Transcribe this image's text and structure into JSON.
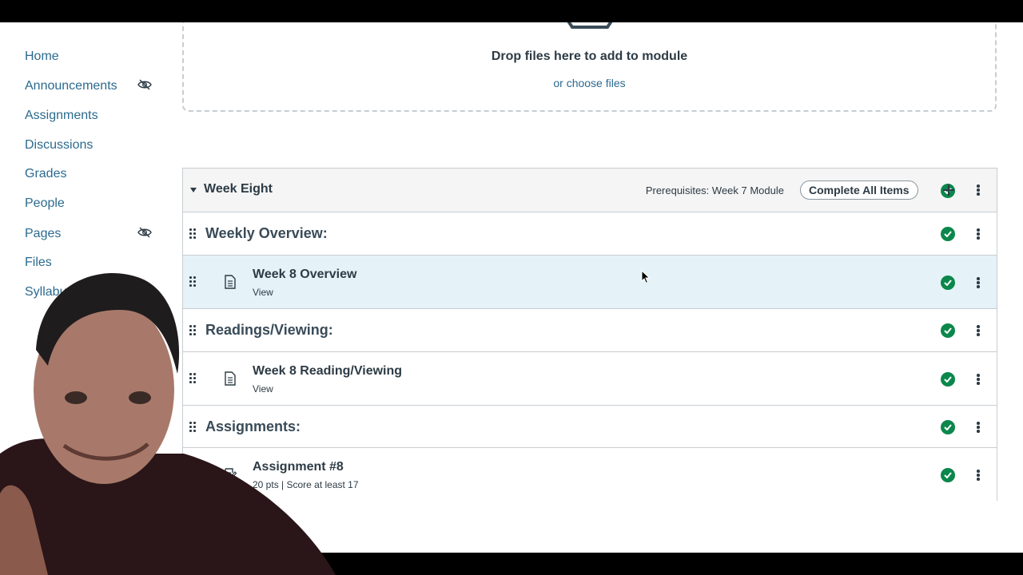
{
  "sidebar": {
    "items": [
      {
        "label": "Home"
      },
      {
        "label": "Announcements",
        "hidden_icon": "eye-slash-icon"
      },
      {
        "label": "Assignments"
      },
      {
        "label": "Discussions"
      },
      {
        "label": "Grades"
      },
      {
        "label": "People"
      },
      {
        "label": "Pages",
        "hidden_icon": "eye-slash-icon"
      },
      {
        "label": "Files"
      },
      {
        "label": "Syllabus"
      }
    ]
  },
  "upload": {
    "title": "Drop files here to add to module",
    "link": "or choose files"
  },
  "module": {
    "title": "Week Eight",
    "prerequisites": "Prerequisites: Week 7 Module",
    "requirement": "Complete All Items",
    "items": [
      {
        "type": "subheader",
        "title": "Weekly Overview:"
      },
      {
        "type": "page",
        "title": "Week 8 Overview",
        "meta": "View",
        "selected": true
      },
      {
        "type": "subheader",
        "title": "Readings/Viewing:"
      },
      {
        "type": "page",
        "title": "Week 8 Reading/Viewing",
        "meta": "View"
      },
      {
        "type": "subheader",
        "title": "Assignments:"
      },
      {
        "type": "assignment",
        "title": "Assignment #8",
        "meta": "20 pts  |  Score at least 17"
      }
    ]
  },
  "colors": {
    "link": "#2b6a8e",
    "complete_check": "#0b874b",
    "selected_row": "#e5f2f8",
    "header_bg": "#f5f5f5"
  }
}
